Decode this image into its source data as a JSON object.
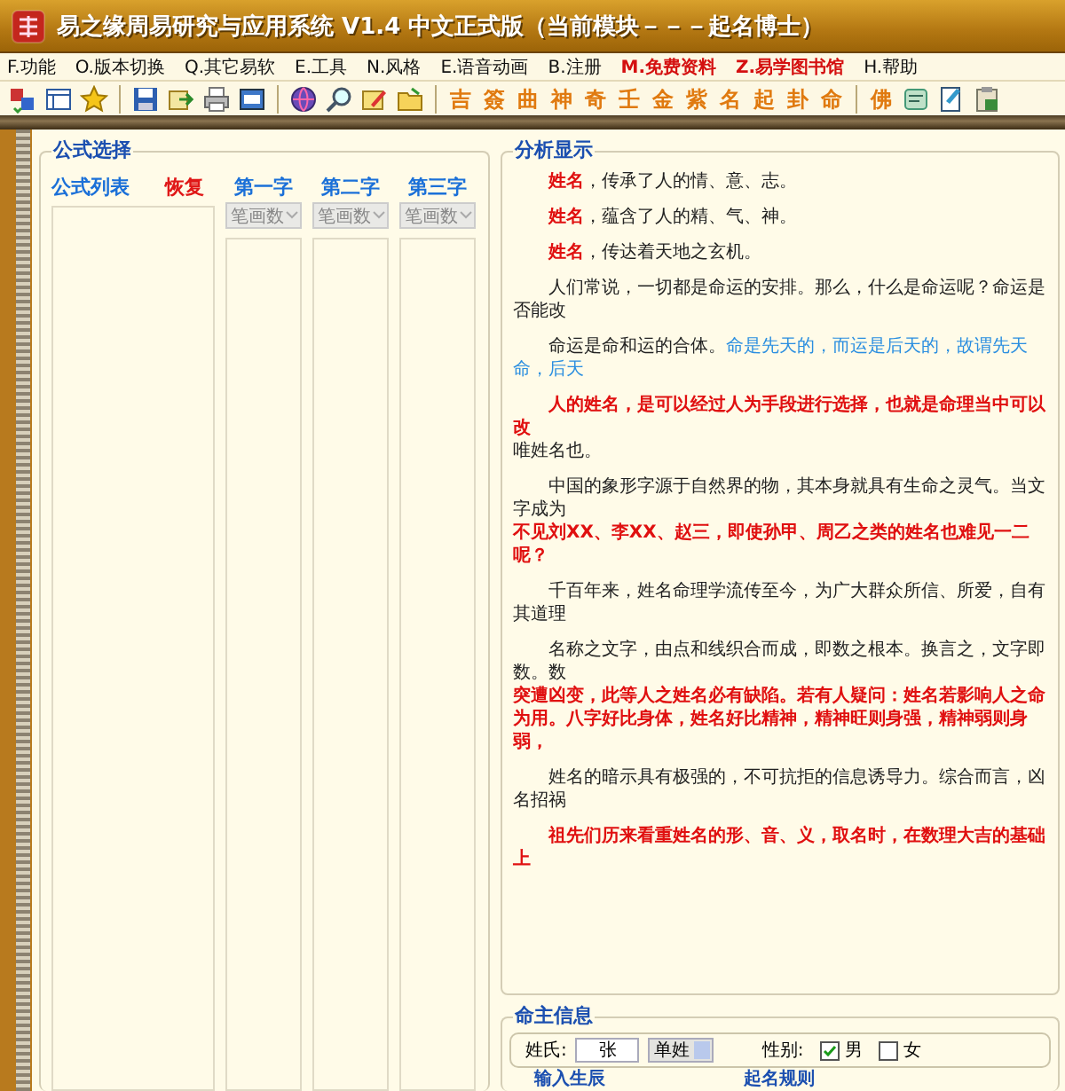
{
  "window": {
    "title": "易之缘周易研究与应用系统 V1.4 中文正式版（当前模块－－－起名博士）"
  },
  "menu": [
    {
      "label": "F.功能",
      "highlight": false
    },
    {
      "label": "O.版本切换",
      "highlight": false
    },
    {
      "label": "Q.其它易软",
      "highlight": false
    },
    {
      "label": "E.工具",
      "highlight": false
    },
    {
      "label": "N.风格",
      "highlight": false
    },
    {
      "label": "E.语音动画",
      "highlight": false
    },
    {
      "label": "B.注册",
      "highlight": false
    },
    {
      "label": "M.免费资料",
      "highlight": true
    },
    {
      "label": "Z.易学图书馆",
      "highlight": true
    },
    {
      "label": "H.帮助",
      "highlight": false
    }
  ],
  "toolbar": {
    "char_buttons": [
      "吉",
      "簽",
      "曲",
      "神",
      "奇",
      "壬",
      "金",
      "紫",
      "名",
      "起",
      "卦",
      "命"
    ],
    "extra_char_button": "佛"
  },
  "formula_panel": {
    "title": "公式选择",
    "list_label": "公式列表",
    "restore_button": "恢复",
    "columns": [
      {
        "label": "第一字",
        "sort": "笔画数",
        "disabled": true
      },
      {
        "label": "第二字",
        "sort": "笔画数",
        "disabled": true
      },
      {
        "label": "第三字",
        "sort": "笔画数",
        "disabled": true
      }
    ]
  },
  "analysis": {
    "title": "分析显示",
    "paragraphs": [
      {
        "lines": [
          {
            "indent": true,
            "runs": [
              {
                "text": "姓名",
                "kind": "emphasis"
              },
              {
                "text": "，传承了人的情、意、志。",
                "kind": "normal"
              }
            ]
          }
        ]
      },
      {
        "lines": [
          {
            "indent": true,
            "runs": [
              {
                "text": "姓名",
                "kind": "emphasis"
              },
              {
                "text": "，蕴含了人的精、气、神。",
                "kind": "normal"
              }
            ]
          }
        ]
      },
      {
        "lines": [
          {
            "indent": true,
            "runs": [
              {
                "text": "姓名",
                "kind": "emphasis"
              },
              {
                "text": "，传达着天地之玄机。",
                "kind": "normal"
              }
            ]
          }
        ]
      },
      {
        "lines": [
          {
            "indent": true,
            "runs": [
              {
                "text": "人们常说，一切都是命运的安排。那么，什么是命运呢？命运是否能改",
                "kind": "normal"
              }
            ]
          }
        ]
      },
      {
        "lines": [
          {
            "indent": true,
            "runs": [
              {
                "text": "命运是命和运的合体。",
                "kind": "normal"
              },
              {
                "text": "命是先天的，而运是后天的，故谓先天命，后天",
                "kind": "note"
              }
            ]
          }
        ]
      },
      {
        "lines": [
          {
            "indent": true,
            "runs": [
              {
                "text": "人的姓名，是可以经过人为手段进行选择，也就是命理当中可以改",
                "kind": "emphasis"
              }
            ]
          },
          {
            "indent": false,
            "runs": [
              {
                "text": "唯姓名也。",
                "kind": "normal"
              }
            ]
          }
        ]
      },
      {
        "lines": [
          {
            "indent": true,
            "runs": [
              {
                "text": "中国的象形字源于自然界的物，其本身就具有生命之灵气。当文字成为",
                "kind": "normal"
              }
            ]
          },
          {
            "indent": false,
            "runs": [
              {
                "text": "不见刘XX、李XX、赵三，即使孙甲、周乙之类的姓名也难见一二呢？",
                "kind": "emphasis"
              }
            ]
          }
        ]
      },
      {
        "lines": [
          {
            "indent": true,
            "runs": [
              {
                "text": "千百年来，姓名命理学流传至今，为广大群众所信、所爱，自有其道理",
                "kind": "normal"
              }
            ]
          }
        ]
      },
      {
        "lines": [
          {
            "indent": true,
            "runs": [
              {
                "text": "名称之文字，由点和线织合而成，即数之根本。换言之，文字即数。数",
                "kind": "normal"
              }
            ]
          },
          {
            "indent": false,
            "runs": [
              {
                "text": "突遭凶变，此等人之姓名必有缺陷。若有人疑问：姓名若影响人之命",
                "kind": "emphasis"
              }
            ]
          },
          {
            "indent": false,
            "runs": [
              {
                "text": "为用。八字好比身体，姓名好比精神，精神旺则身强，精神弱则身弱，",
                "kind": "emphasis"
              }
            ]
          }
        ]
      },
      {
        "lines": [
          {
            "indent": true,
            "runs": [
              {
                "text": "姓名的暗示具有极强的，不可抗拒的信息诱导力。综合而言，凶名招祸",
                "kind": "normal"
              }
            ]
          }
        ]
      },
      {
        "lines": [
          {
            "indent": true,
            "runs": [
              {
                "text": "祖先们历来看重姓名的形、音、义，取名时，在数理大吉的基础上",
                "kind": "emphasis"
              }
            ]
          }
        ]
      }
    ]
  },
  "owner_info": {
    "title": "命主信息",
    "surname_label": "姓氏:",
    "surname": "张",
    "surname_type": "单姓",
    "gender_label": "性别:",
    "genders": [
      {
        "label": "男",
        "checked": true
      },
      {
        "label": "女",
        "checked": false
      }
    ],
    "tabs": [
      "输入生辰",
      "起名规则"
    ]
  }
}
